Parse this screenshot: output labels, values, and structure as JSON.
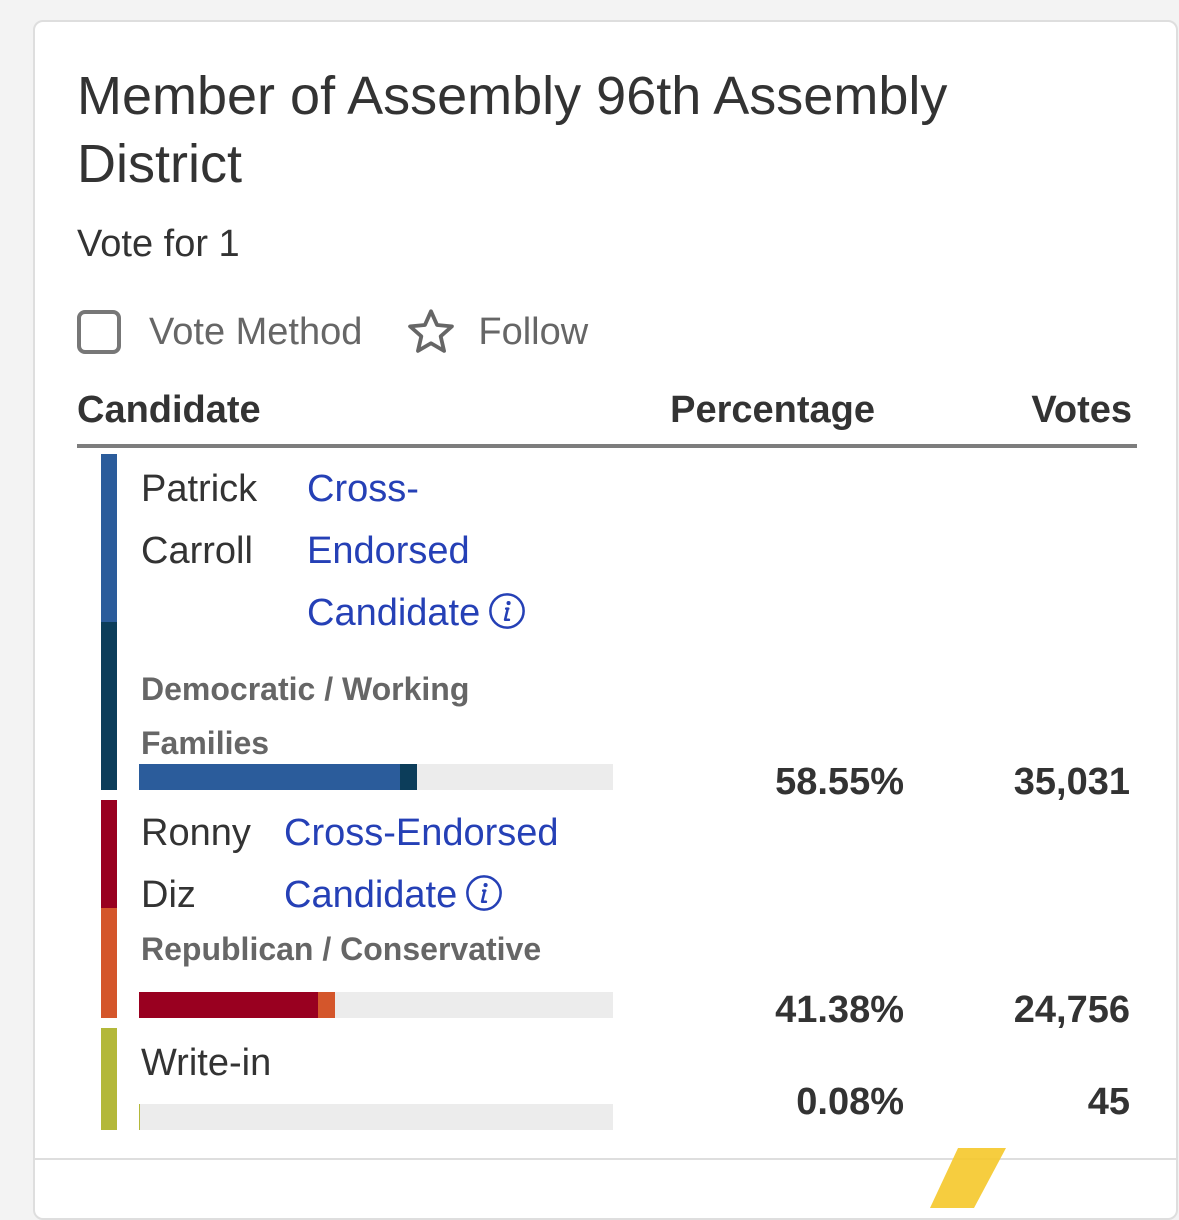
{
  "contest": {
    "title": "Member of Assembly 96th Assembly District",
    "subtitle": "Vote for 1"
  },
  "toolbar": {
    "vote_method_label": "Vote Method",
    "follow_label": "Follow",
    "vote_method_checked": false
  },
  "table": {
    "headers": {
      "candidate": "Candidate",
      "percentage": "Percentage",
      "votes": "Votes"
    },
    "rows": [
      {
        "name_line1": "Patrick",
        "name_line2": "Carroll",
        "endorse_line1": "Cross-",
        "endorse_line2": "Endorsed",
        "endorse_line3": "Candidate",
        "party_line1": "Democratic / Working",
        "party_line2": "Families",
        "percentage": "58.55%",
        "votes": "35,031",
        "share": 0.5855,
        "party_colors": [
          "#2b5c9b",
          "#0c3d5a"
        ],
        "party_vote_shares": [
          0.5512,
          0.0343
        ]
      },
      {
        "name_line1": "Ronny",
        "name_line2": "Diz",
        "endorse_line1": "Cross-Endorsed",
        "endorse_line2": "Candidate",
        "party_line1": "Republican / Conservative",
        "percentage": "41.38%",
        "votes": "24,756",
        "share": 0.4138,
        "party_colors": [
          "#990020",
          "#d4562b"
        ],
        "party_vote_shares": [
          0.3778,
          0.036
        ]
      },
      {
        "name_line1": "Write-in",
        "percentage": "0.08%",
        "votes": "45",
        "share": 0.0008,
        "party_colors": [
          "#b3b83a"
        ]
      }
    ]
  },
  "colors": {
    "endorsed_link": "#2540b6",
    "header_rule": "#7d7d7d",
    "bar_track": "#ececec"
  },
  "icons": {
    "checkbox": "checkbox-icon",
    "star": "star-outline-icon",
    "info": "info-icon"
  }
}
